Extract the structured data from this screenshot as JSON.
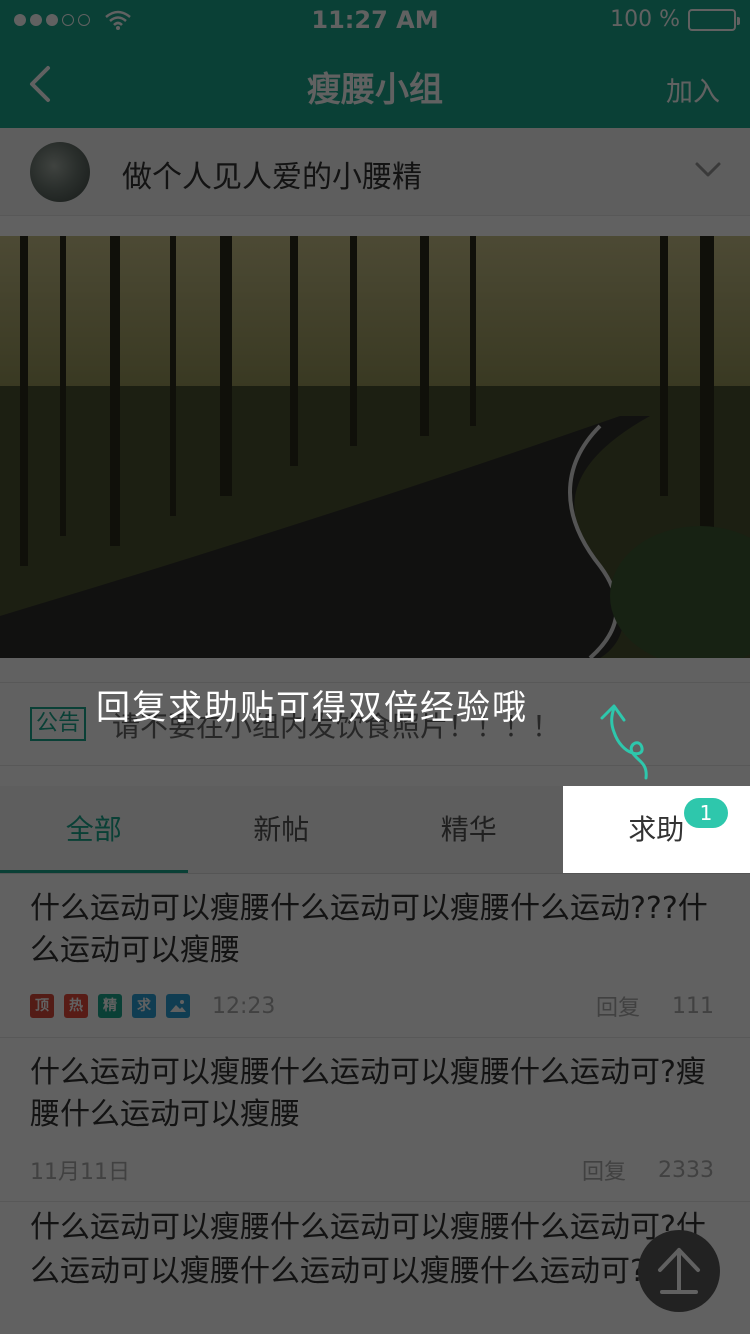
{
  "status_bar": {
    "time": "11:27 AM",
    "battery_text": "100 %",
    "signal_bars": [
      true,
      true,
      true,
      false,
      false
    ]
  },
  "nav": {
    "title": "瘦腰小组",
    "join_label": "加入",
    "back_icon": "chevron-left-icon"
  },
  "group": {
    "name": "做个人见人爱的小腰精",
    "expand_icon": "chevron-down-icon"
  },
  "banner": {
    "page_count": 4,
    "active_index": 3
  },
  "notice": {
    "badge": "公告",
    "text": "请不要在小组内发饮食照片！！！！"
  },
  "coach_mark": {
    "text": "回复求助贴可得双倍经验哦"
  },
  "tabs": [
    {
      "label": "全部",
      "active": true
    },
    {
      "label": "新帖",
      "active": false
    },
    {
      "label": "精华",
      "active": false
    },
    {
      "label": "求助",
      "active": false,
      "badge": "1"
    }
  ],
  "posts": [
    {
      "title": "什么运动可以瘦腰什么运动可以瘦腰什么运动???什么运动可以瘦腰",
      "tags": [
        "顶",
        "热",
        "精",
        "求",
        "图"
      ],
      "time": "12:23",
      "reply_label": "回复",
      "reply_count": "111"
    },
    {
      "title": "什么运动可以瘦腰什么运动可以瘦腰什么运动可?瘦腰什么运动可以瘦腰",
      "tags": [],
      "time": "11月11日",
      "reply_label": "回复",
      "reply_count": "2333"
    },
    {
      "title": "什么运动可以瘦腰什么运动可以瘦腰什么运动可?什么运动可以瘦腰什么运动可以瘦腰什么运动可?",
      "tags": [],
      "time": "",
      "reply_label": "",
      "reply_count": ""
    }
  ],
  "colors": {
    "brand": "#1ba98f",
    "badge": "#2ec7ac",
    "overlay": "rgba(0,0,0,0.62)"
  },
  "fab_icon": "arrow-up-icon"
}
